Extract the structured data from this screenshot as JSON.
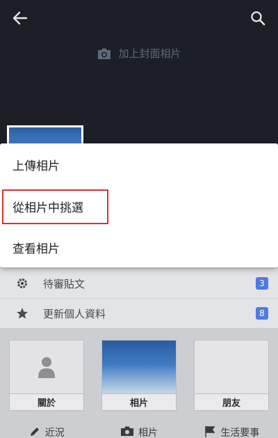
{
  "cover": {
    "add_cover_label": "加上封面相片"
  },
  "menu": {
    "items": [
      {
        "label": "上傳相片"
      },
      {
        "label": "從相片中挑選"
      },
      {
        "label": "查看相片"
      }
    ],
    "highlighted_index": 1,
    "highlight_color": "#e22c2c"
  },
  "profile_list": {
    "rows": [
      {
        "label": "待審貼文",
        "badge": "3",
        "icon": "gear-icon"
      },
      {
        "label": "更新個人資料",
        "badge": "8",
        "icon": "star-icon"
      }
    ]
  },
  "tiles": [
    {
      "label": "關於",
      "icon": "person-icon"
    },
    {
      "label": "相片",
      "icon": "photo-thumbnail"
    },
    {
      "label": "朋友",
      "icon": "none"
    }
  ],
  "bottom_bar": {
    "items": [
      {
        "label": "近況",
        "icon": "edit-icon"
      },
      {
        "label": "相片",
        "icon": "camera-icon"
      },
      {
        "label": "生活要事",
        "icon": "flag-icon"
      }
    ]
  },
  "colors": {
    "cover_bg": "#1c2026",
    "badge": "#4f7be0"
  }
}
